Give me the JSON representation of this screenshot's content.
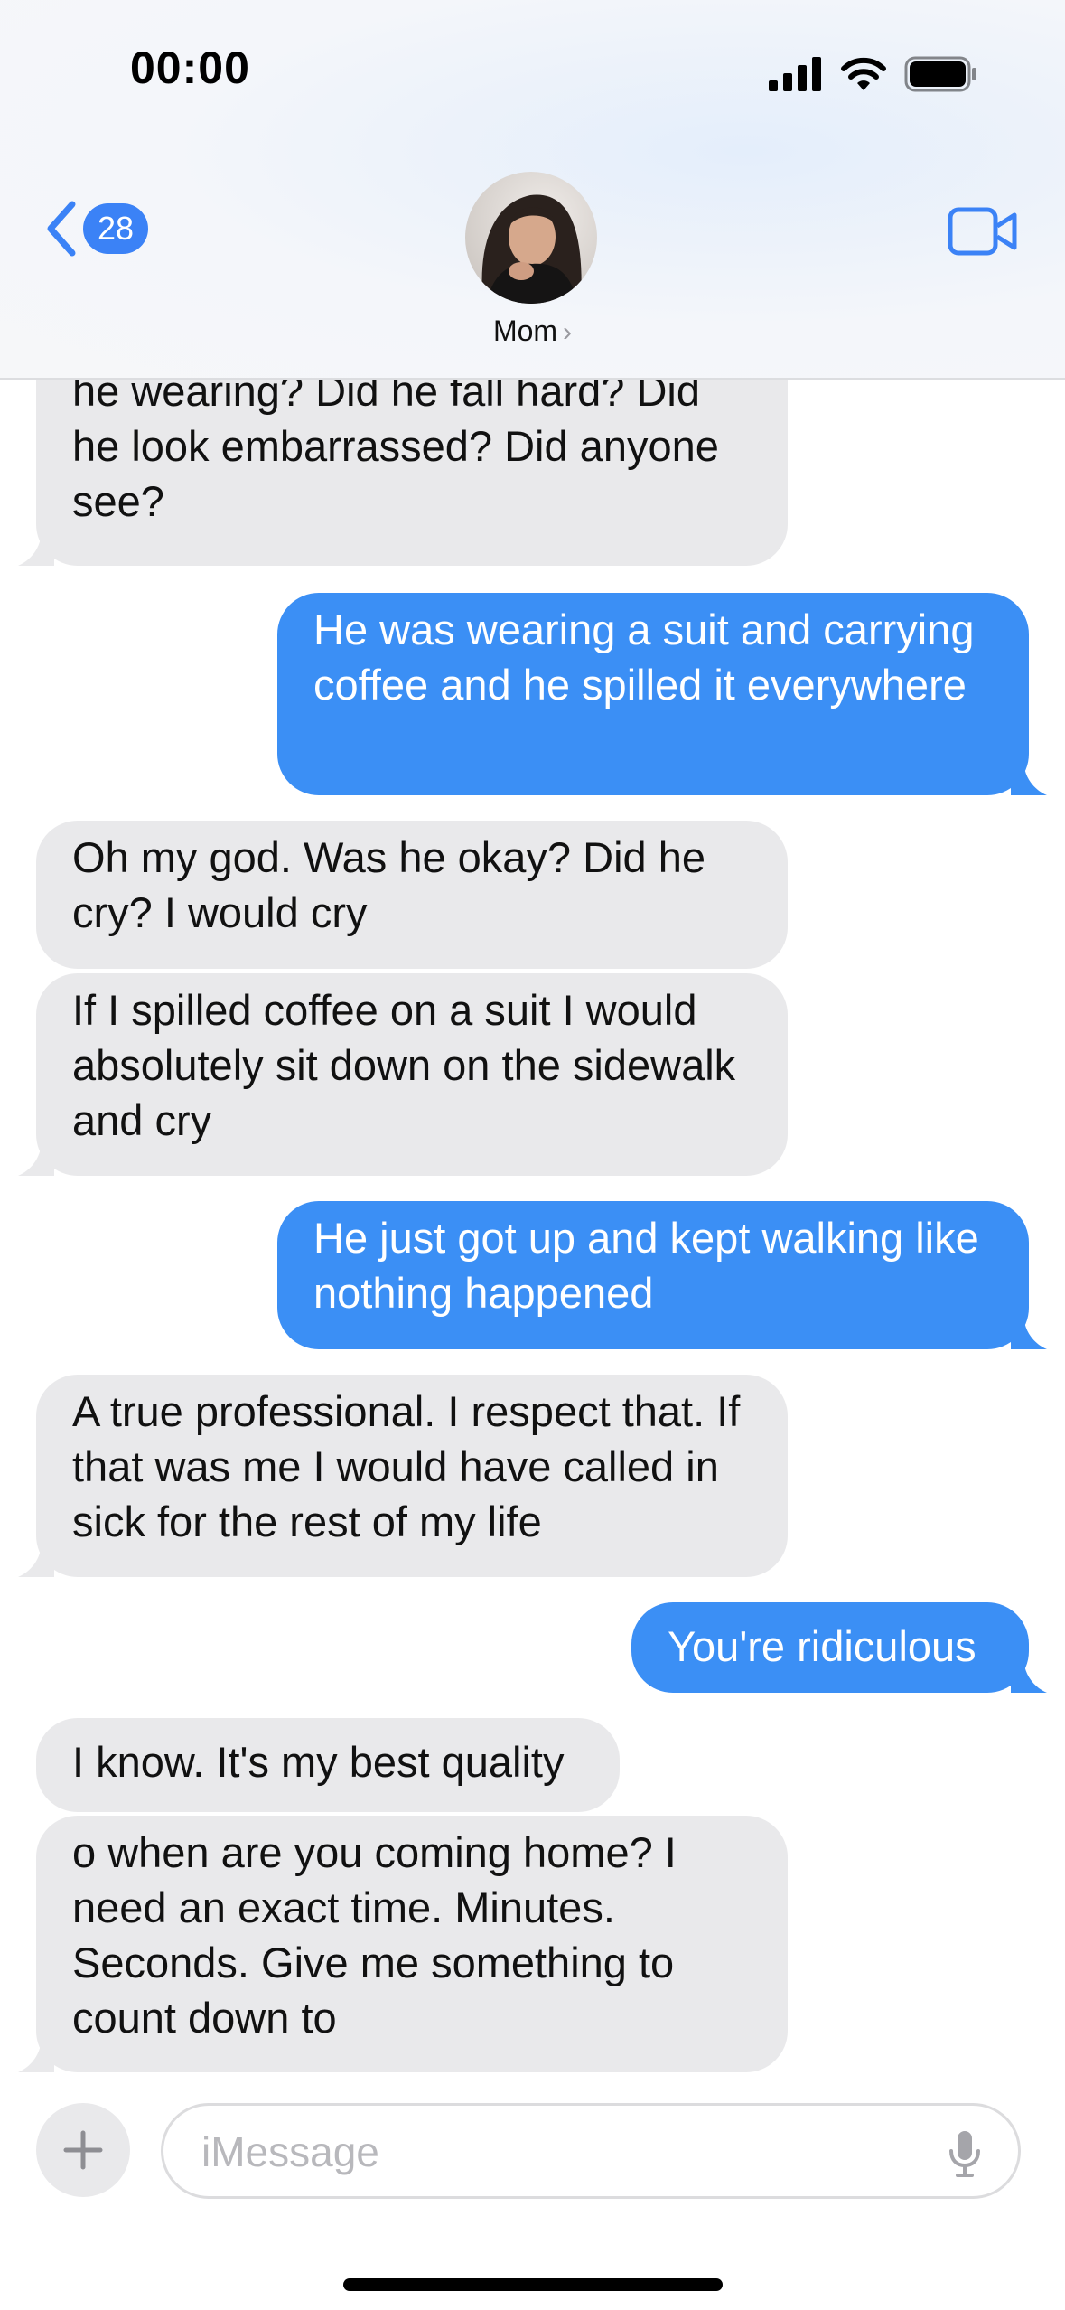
{
  "status_bar": {
    "time": "00:00"
  },
  "header": {
    "back_count": "28",
    "contact_name": "Mom",
    "name_chevron": "›"
  },
  "messages": [
    {
      "from": "them",
      "text": "he wearing? Did he fall hard? Did he look embarrassed? Did anyone see?"
    },
    {
      "from": "me",
      "text": "He was wearing a suit and carrying coffee and he spilled it everywhere"
    },
    {
      "from": "them",
      "text": "Oh my god. Was he okay? Did he cry? I would cry"
    },
    {
      "from": "them",
      "text": "If I spilled coffee on a suit I would absolutely sit down on the sidewalk and cry"
    },
    {
      "from": "me",
      "text": "He just got up and kept walking like nothing happened"
    },
    {
      "from": "them",
      "text": "A true professional. I respect that. If that was me I would have called in sick for the rest of my life"
    },
    {
      "from": "me",
      "text": "You're ridiculous"
    },
    {
      "from": "them",
      "text": "I know. It's my best quality"
    },
    {
      "from": "them",
      "text": "o when are you coming home? I need an exact time. Minutes. Seconds. Give me something to count down to"
    }
  ],
  "composer": {
    "placeholder": "iMessage",
    "value": ""
  },
  "colors": {
    "accent": "#3b82f6",
    "outgoing_bubble": "#3b8ff5",
    "incoming_bubble": "#e9e9eb"
  },
  "icons": [
    "signal-icon",
    "wifi-icon",
    "battery-icon",
    "back-chevron-icon",
    "video-call-icon",
    "plus-icon",
    "microphone-icon"
  ]
}
